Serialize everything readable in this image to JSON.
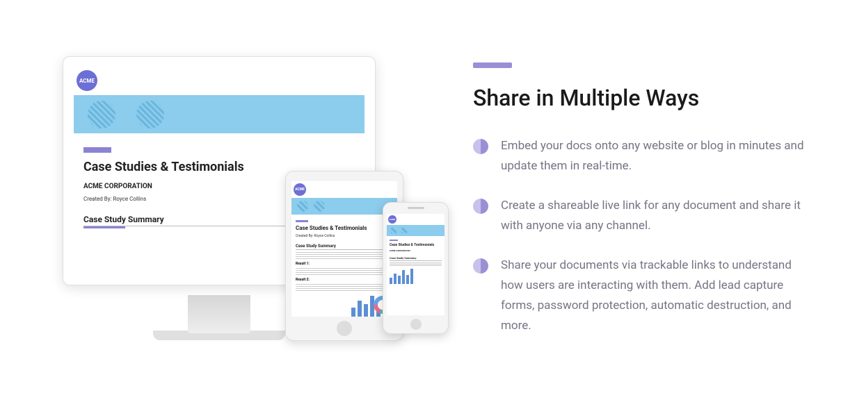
{
  "heading": "Share in Multiple Ways",
  "bullets": [
    "Embed your docs onto any website or blog in minutes and update them in real-time.",
    "Create a shareable live link for any document and share it with anyone via any channel.",
    "Share your documents via trackable links to understand how users are interacting with them. Add lead capture forms, password protection, automatic destruction, and more."
  ],
  "doc": {
    "brand": "ACME",
    "title": "Case Studies & Testimonials",
    "company": "ACME CORPORATION",
    "author": "Created By: Royce Collins",
    "section": "Case Study Summary",
    "result1": "Result 1:",
    "result2": "Result 2:"
  }
}
